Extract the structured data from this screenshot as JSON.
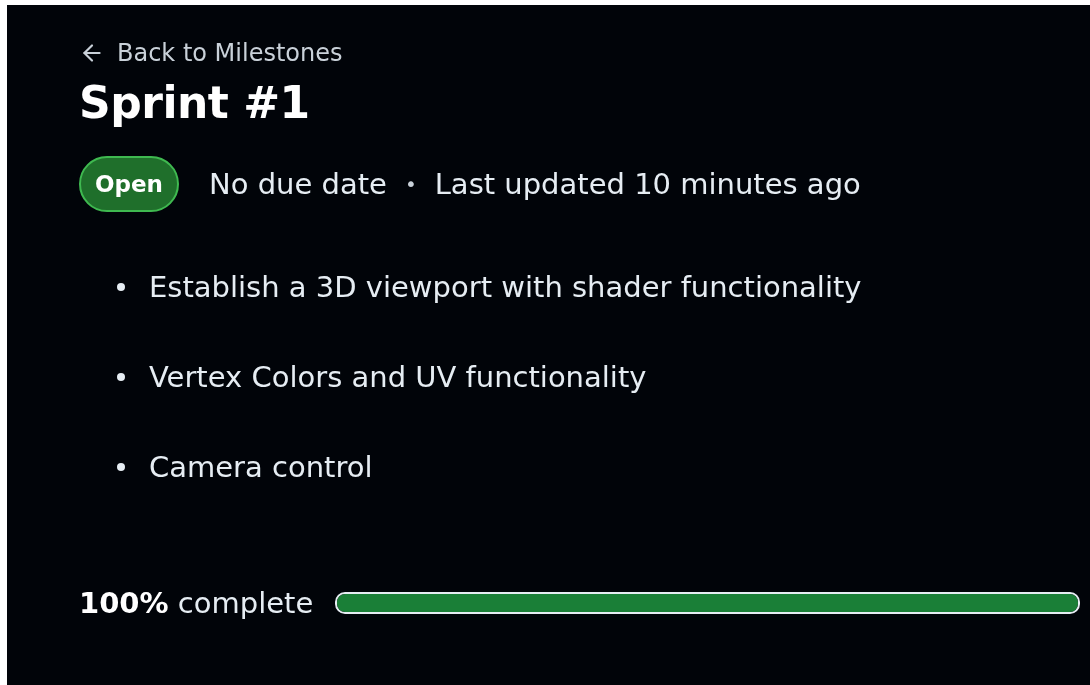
{
  "back_link": {
    "label": "Back to Milestones"
  },
  "title": "Sprint #1",
  "status": {
    "label": "Open"
  },
  "meta": {
    "due": "No due date",
    "separator": "•",
    "updated": "Last updated 10 minutes ago"
  },
  "goals": [
    "Establish a 3D viewport with shader functionality",
    "Vertex Colors and UV functionality",
    "Camera control"
  ],
  "progress": {
    "label": "**100%** complete",
    "level": 1
  }
}
